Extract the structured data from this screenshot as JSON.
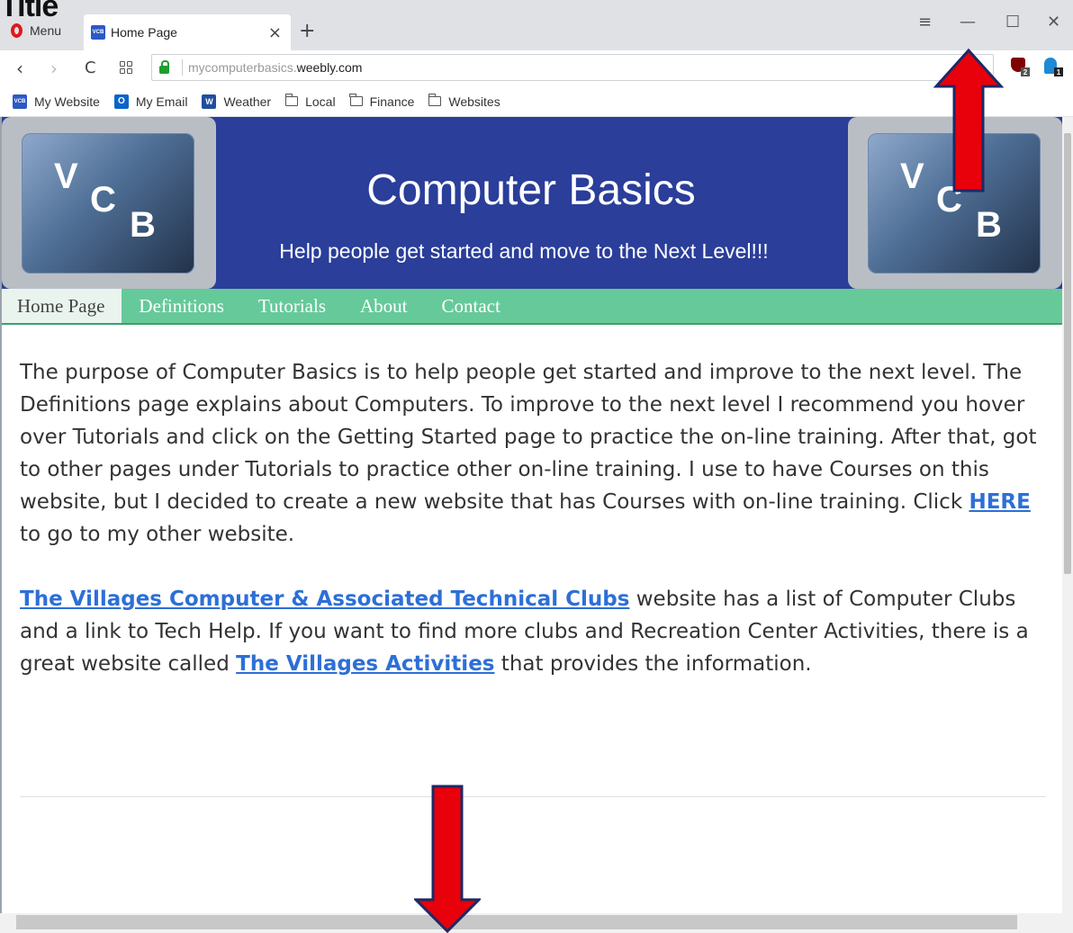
{
  "page_title_cut": "Title",
  "browser": {
    "menu_label": "Menu",
    "tab": {
      "favicon": "VCB",
      "title": "Home Page",
      "close": "×"
    },
    "new_tab": "+",
    "window_controls": {
      "menu": "≡",
      "minimize": "—",
      "maximize": "☐",
      "close": "✕"
    },
    "nav": {
      "back": "‹",
      "forward": "›",
      "reload": "C"
    },
    "url": {
      "prefix": "mycomputerbasics.",
      "domain": "weebly.com"
    },
    "extensions": [
      {
        "name": "ublock-icon",
        "badge": "2"
      },
      {
        "name": "ghostery-icon",
        "badge": "1"
      }
    ]
  },
  "bookmarks": [
    {
      "label": "My Website",
      "icon": "vcb-icon",
      "color": "#2d59c4",
      "glyph": "VCB"
    },
    {
      "label": "My Email",
      "icon": "outlook-icon",
      "color": "#0a64c8",
      "glyph": "O"
    },
    {
      "label": "Weather",
      "icon": "weather-channel-icon",
      "color": "#1f4fa0",
      "glyph": "W"
    },
    {
      "label": "Local",
      "icon": "folder-icon"
    },
    {
      "label": "Finance",
      "icon": "folder-icon"
    },
    {
      "label": "Websites",
      "icon": "folder-icon"
    }
  ],
  "site": {
    "title": "Computer Basics",
    "tagline": "Help people get started and move to the Next Level!!!",
    "logo": {
      "v": "V",
      "c": "C",
      "b": "B"
    },
    "menu": [
      "Home Page",
      "Definitions",
      "Tutorials",
      "About",
      "Contact"
    ],
    "paragraph1": {
      "text": "The purpose of Computer Basics is to help people get started and improve to the next level. The Definitions page explains about Computers.  To improve to the next level I recommend you hover over Tutorials and click on the Getting Started page to practice the on-line training.  After that, got to other pages under Tutorials to practice other on-line training.  I use to have Courses on this website, but I decided to create a new website that has Courses with on-line training.  Click ",
      "link": "HERE",
      "after": " to go to my other website."
    },
    "paragraph2": {
      "link1": "The Villages Computer & Associated Technical Clubs",
      "text": " website has a list of Computer Clubs and a link to Tech Help.  If you want to find more clubs and Recreation Center Activities, there is a great website called ",
      "link2": "The Villages Activities",
      "after": " that provides the information."
    }
  },
  "colors": {
    "header": "#2a3e9a",
    "menu": "#66c99a",
    "link": "#2d6fd6",
    "arrow": "#e8000b"
  }
}
